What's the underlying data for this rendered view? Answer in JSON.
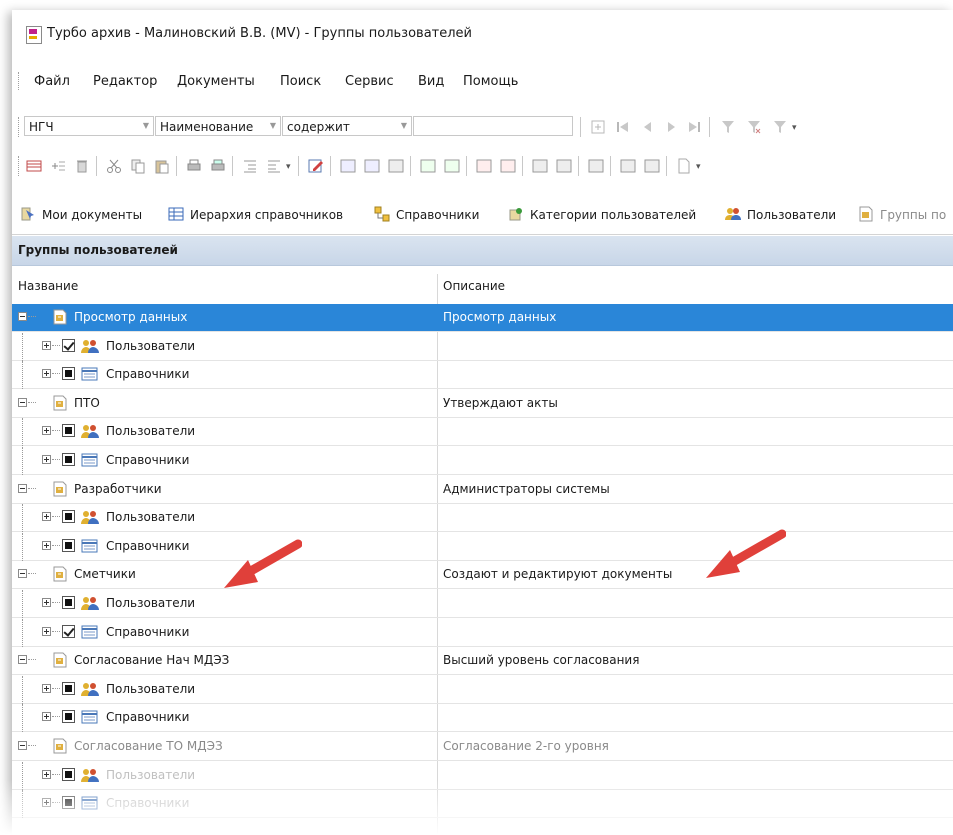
{
  "window": {
    "title": "Турбо архив - Малиновский В.В. (MV) - Группы пользователей"
  },
  "menu": [
    "Файл",
    "Редактор",
    "Документы",
    "Поиск",
    "Сервис",
    "Вид",
    "Помощь"
  ],
  "filter": {
    "field1": "НГЧ",
    "field2": "Наименование",
    "operator": "содержит",
    "value": ""
  },
  "tabs": [
    {
      "label": "Мои документы",
      "icon": "documents-icon"
    },
    {
      "label": "Иерархия справочников",
      "icon": "hierarchy-icon"
    },
    {
      "label": "Справочники",
      "icon": "dictionaries-icon"
    },
    {
      "label": "Категории пользователей",
      "icon": "user-categories-icon"
    },
    {
      "label": "Пользователи",
      "icon": "users-icon"
    },
    {
      "label": "Группы по",
      "icon": "groups-icon"
    }
  ],
  "panel": {
    "title": "Группы пользователей"
  },
  "columns": {
    "name": "Название",
    "description": "Описание"
  },
  "labels": {
    "users": "Пользователи",
    "dictionaries": "Справочники"
  },
  "groups": [
    {
      "name": "Просмотр данных",
      "description": "Просмотр данных",
      "users_state": "checked",
      "dicts_state": "filled"
    },
    {
      "name": "ПТО",
      "description": "Утверждают акты",
      "users_state": "filled",
      "dicts_state": "filled"
    },
    {
      "name": "Разработчики",
      "description": "Администраторы системы",
      "users_state": "filled",
      "dicts_state": "filled"
    },
    {
      "name": "Сметчики",
      "description": "Создают и редактируют документы",
      "users_state": "filled",
      "dicts_state": "checked"
    },
    {
      "name": "Согласование Нач МДЭЗ",
      "description": "Высший уровень согласования",
      "users_state": "filled",
      "dicts_state": "filled"
    },
    {
      "name": "Согласование ТО МДЭЗ",
      "description": "Согласование 2-го уровня",
      "users_state": "filled",
      "dicts_state": "filled"
    }
  ],
  "colors": {
    "selection": "#2a86d8",
    "arrow": "#e0403a",
    "panel_header": "#d4e0ee"
  }
}
